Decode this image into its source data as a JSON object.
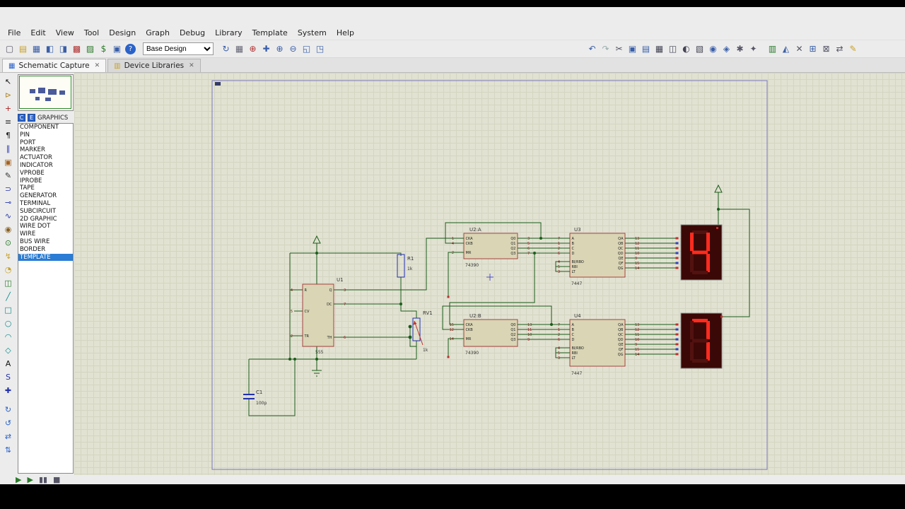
{
  "menu": {
    "items": [
      "File",
      "Edit",
      "View",
      "Tool",
      "Design",
      "Graph",
      "Debug",
      "Library",
      "Template",
      "System",
      "Help"
    ]
  },
  "toolbar": {
    "design_select": "Base Design",
    "icons_left": [
      {
        "name": "new-project-icon",
        "glyph": "▢",
        "color": "#556"
      },
      {
        "name": "open-project-icon",
        "glyph": "▤",
        "color": "#c9a227"
      },
      {
        "name": "save-project-icon",
        "glyph": "▦",
        "color": "#3a5fa8"
      },
      {
        "name": "import-icon",
        "glyph": "◧",
        "color": "#3a5fa8"
      },
      {
        "name": "export-icon",
        "glyph": "◨",
        "color": "#3a5fa8"
      },
      {
        "name": "schematic-capture-icon",
        "glyph": "▩",
        "color": "#b03030"
      },
      {
        "name": "pcb-layout-icon",
        "glyph": "▨",
        "color": "#2a7a2a"
      },
      {
        "name": "bill-of-materials-icon",
        "glyph": "$",
        "color": "#2a7a2a"
      },
      {
        "name": "design-explorer-icon",
        "glyph": "▣",
        "color": "#3a5fa8"
      },
      {
        "name": "help-icon",
        "glyph": "?",
        "color": "#ffffff",
        "bg": "#2a62c9"
      }
    ],
    "icons_mid": [
      {
        "name": "refresh-icon",
        "glyph": "↻",
        "color": "#3a5fa8"
      },
      {
        "name": "grid-toggle-icon",
        "glyph": "▦",
        "color": "#667"
      },
      {
        "name": "origin-icon",
        "glyph": "⊕",
        "color": "#b03030"
      },
      {
        "name": "pan-icon",
        "glyph": "✚",
        "color": "#3a5fa8"
      },
      {
        "name": "zoom-in-icon",
        "glyph": "⊕",
        "color": "#3a5fa8"
      },
      {
        "name": "zoom-out-icon",
        "glyph": "⊖",
        "color": "#3a5fa8"
      },
      {
        "name": "zoom-area-icon",
        "glyph": "◱",
        "color": "#3a5fa8"
      },
      {
        "name": "zoom-all-icon",
        "glyph": "◳",
        "color": "#3a5fa8"
      }
    ],
    "icons_right": [
      {
        "name": "undo-icon",
        "glyph": "↶",
        "color": "#3a5fa8"
      },
      {
        "name": "redo-icon",
        "glyph": "↷",
        "color": "#9aa"
      },
      {
        "name": "cut-icon",
        "glyph": "✂",
        "color": "#556"
      },
      {
        "name": "copy-icon",
        "glyph": "▣",
        "color": "#3a5fa8"
      },
      {
        "name": "paste-icon",
        "glyph": "▤",
        "color": "#3a5fa8"
      },
      {
        "name": "block-copy-icon",
        "glyph": "▦",
        "color": "#445"
      },
      {
        "name": "block-move-icon",
        "glyph": "◫",
        "color": "#445"
      },
      {
        "name": "block-rotate-icon",
        "glyph": "◐",
        "color": "#445"
      },
      {
        "name": "block-delete-icon",
        "glyph": "▧",
        "color": "#445"
      },
      {
        "name": "pick-device-icon",
        "glyph": "◉",
        "color": "#3a5fa8"
      },
      {
        "name": "make-device-icon",
        "glyph": "◈",
        "color": "#3a5fa8"
      },
      {
        "name": "packaging-tool-icon",
        "glyph": "✱",
        "color": "#556"
      },
      {
        "name": "decompose-icon",
        "glyph": "✦",
        "color": "#556"
      }
    ],
    "icons_far": [
      {
        "name": "electrical-rule-check-icon",
        "glyph": "▥",
        "color": "#2a7a2a"
      },
      {
        "name": "netlist-compile-icon",
        "glyph": "◭",
        "color": "#3a5fa8"
      },
      {
        "name": "search-tag-icon",
        "glyph": "✕",
        "color": "#556"
      },
      {
        "name": "add-sheet-icon",
        "glyph": "⊞",
        "color": "#3a5fa8"
      },
      {
        "name": "remove-sheet-icon",
        "glyph": "⊠",
        "color": "#556"
      },
      {
        "name": "exchange-sheet-icon",
        "glyph": "⇄",
        "color": "#556"
      },
      {
        "name": "edit-properties-icon",
        "glyph": "✎",
        "color": "#c9a227"
      }
    ]
  },
  "tabs": {
    "tab1": "Schematic Capture",
    "tab2": "Device Libraries",
    "close_glyph": "✕"
  },
  "side_tools": [
    {
      "name": "selection-pointer-icon",
      "glyph": "↖",
      "color": "#111"
    },
    {
      "name": "component-mode-icon",
      "glyph": "⊳",
      "color": "#b08828"
    },
    {
      "name": "junction-dot-mode-icon",
      "glyph": "+",
      "color": "#aa2222"
    },
    {
      "name": "wire-label-mode-icon",
      "glyph": "≡",
      "color": "#333"
    },
    {
      "name": "text-script-mode-icon",
      "glyph": "¶",
      "color": "#333"
    },
    {
      "name": "buses-mode-icon",
      "glyph": "∥",
      "color": "#2233aa"
    },
    {
      "name": "subcircuit-mode-icon",
      "glyph": "▣",
      "color": "#a66222"
    },
    {
      "name": "instant-edit-mode-icon",
      "glyph": "✎",
      "color": "#333"
    },
    {
      "name": "terminals-mode-icon",
      "glyph": "⊃",
      "color": "#2233aa"
    },
    {
      "name": "device-pin-mode-icon",
      "glyph": "⊸",
      "color": "#2233aa"
    },
    {
      "name": "graph-mode-icon",
      "glyph": "∿",
      "color": "#2233aa"
    },
    {
      "name": "tape-recorder-mode-icon",
      "glyph": "◉",
      "color": "#886222"
    },
    {
      "name": "generator-mode-icon",
      "glyph": "⊙",
      "color": "#2a7a2a"
    },
    {
      "name": "voltage-probe-mode-icon",
      "glyph": "↯",
      "color": "#c9a227"
    },
    {
      "name": "current-probe-mode-icon",
      "glyph": "◔",
      "color": "#c9a227"
    },
    {
      "name": "virtual-instruments-mode-icon",
      "glyph": "◫",
      "color": "#2a7a2a"
    },
    {
      "name": "2d-line-mode-icon",
      "glyph": "╱",
      "color": "#0a8a8a"
    },
    {
      "name": "2d-box-mode-icon",
      "glyph": "□",
      "color": "#0a8a8a"
    },
    {
      "name": "2d-circle-mode-icon",
      "glyph": "○",
      "color": "#0a8a8a"
    },
    {
      "name": "2d-arc-mode-icon",
      "glyph": "◠",
      "color": "#0a8a8a"
    },
    {
      "name": "2d-path-mode-icon",
      "glyph": "◇",
      "color": "#0a8a8a"
    },
    {
      "name": "2d-text-mode-icon",
      "glyph": "A",
      "color": "#111"
    },
    {
      "name": "2d-symbol-mode-icon",
      "glyph": "S",
      "color": "#2233aa"
    },
    {
      "name": "2d-marker-mode-icon",
      "glyph": "✚",
      "color": "#2233aa"
    }
  ],
  "side_rotate": [
    {
      "name": "rotate-clockwise-icon",
      "glyph": "↻",
      "color": "#2a62c9"
    },
    {
      "name": "rotate-anticlockwise-icon",
      "glyph": "↺",
      "color": "#2a62c9"
    },
    {
      "name": "mirror-x-icon",
      "glyph": "⇄",
      "color": "#2a62c9"
    },
    {
      "name": "mirror-y-icon",
      "glyph": "⇅",
      "color": "#2a62c9"
    }
  ],
  "sidebar": {
    "btn_c": "C",
    "btn_e": "E",
    "header": "GRAPHICS",
    "selected": "TEMPLATE",
    "items": [
      "COMPONENT",
      "PIN",
      "PORT",
      "MARKER",
      "ACTUATOR",
      "INDICATOR",
      "VPROBE",
      "IPROBE",
      "TAPE",
      "GENERATOR",
      "TERMINAL",
      "SUBCIRCUIT",
      "2D GRAPHIC",
      "WIRE DOT",
      "WIRE",
      "BUS WIRE",
      "BORDER",
      "TEMPLATE"
    ]
  },
  "statusbar": {
    "icons": [
      {
        "name": "play-button",
        "glyph": "▶",
        "color": "#2a7a2a"
      },
      {
        "name": "step-button",
        "glyph": "▶",
        "color": "#2a7a2a"
      },
      {
        "name": "pause-button",
        "glyph": "▮▮",
        "color": "#556"
      },
      {
        "name": "stop-button",
        "glyph": "■",
        "color": "#556"
      }
    ]
  },
  "schematic": {
    "wire_color": "#1a5c1a",
    "u1": {
      "ref": "U1",
      "value": "555",
      "left_pins": [
        {
          "num": "4",
          "label": "R"
        },
        {
          "num": "5",
          "label": "CV"
        },
        {
          "num": "2",
          "label": "TR"
        }
      ],
      "right_pins": [
        {
          "num": "3",
          "label": "Q"
        },
        {
          "num": "7",
          "label": "DC"
        },
        {
          "num": "6",
          "label": "TH"
        }
      ]
    },
    "r1": {
      "ref": "R1",
      "value": "1k"
    },
    "rv1": {
      "ref": "RV1",
      "value": "1k"
    },
    "c1": {
      "ref": "C1",
      "value": "100p"
    },
    "u2a": {
      "ref": "U2:A",
      "value": "74390",
      "left_pins": [
        {
          "num": "1",
          "label": "CKA"
        },
        {
          "num": "4",
          "label": "CKB"
        },
        {
          "num": "2",
          "label": "MR"
        }
      ],
      "right_pins": [
        {
          "num": "3",
          "label": "Q0"
        },
        {
          "num": "5",
          "label": "Q1"
        },
        {
          "num": "6",
          "label": "Q2"
        },
        {
          "num": "7",
          "label": "Q3"
        }
      ]
    },
    "u2b": {
      "ref": "U2:B",
      "value": "74390",
      "left_pins": [
        {
          "num": "15",
          "label": "CKA"
        },
        {
          "num": "12",
          "label": "CKB"
        },
        {
          "num": "14",
          "label": "MR"
        }
      ],
      "right_pins": [
        {
          "num": "13",
          "label": "Q0"
        },
        {
          "num": "11",
          "label": "Q1"
        },
        {
          "num": "10",
          "label": "Q2"
        },
        {
          "num": "9",
          "label": "Q3"
        }
      ]
    },
    "u3": {
      "ref": "U3",
      "value": "7447",
      "left_pins": [
        {
          "num": "7",
          "label": "A"
        },
        {
          "num": "1",
          "label": "B"
        },
        {
          "num": "2",
          "label": "C"
        },
        {
          "num": "6",
          "label": "D"
        },
        {
          "num": "4",
          "label": "BI/RBO"
        },
        {
          "num": "5",
          "label": "RBI"
        },
        {
          "num": "3",
          "label": "LT"
        }
      ],
      "right_pins": [
        {
          "num": "13",
          "label": "QA"
        },
        {
          "num": "12",
          "label": "QB"
        },
        {
          "num": "11",
          "label": "QC"
        },
        {
          "num": "10",
          "label": "QD"
        },
        {
          "num": "9",
          "label": "QE"
        },
        {
          "num": "15",
          "label": "QF"
        },
        {
          "num": "14",
          "label": "QG"
        }
      ]
    },
    "u4": {
      "ref": "U4",
      "value": "7447",
      "left_pins": [
        {
          "num": "7",
          "label": "A"
        },
        {
          "num": "1",
          "label": "B"
        },
        {
          "num": "2",
          "label": "C"
        },
        {
          "num": "6",
          "label": "D"
        },
        {
          "num": "4",
          "label": "BI/RBO"
        },
        {
          "num": "5",
          "label": "RBI"
        },
        {
          "num": "3",
          "label": "LT"
        }
      ],
      "right_pins": [
        {
          "num": "13",
          "label": "QA"
        },
        {
          "num": "12",
          "label": "QB"
        },
        {
          "num": "11",
          "label": "QC"
        },
        {
          "num": "10",
          "label": "QD"
        },
        {
          "num": "9",
          "label": "QE"
        },
        {
          "num": "15",
          "label": "QF"
        },
        {
          "num": "14",
          "label": "QG"
        }
      ]
    },
    "displays": [
      {
        "name": "seven-segment-display-1",
        "digit": "4"
      },
      {
        "name": "seven-segment-display-2",
        "digit": "7"
      }
    ]
  }
}
